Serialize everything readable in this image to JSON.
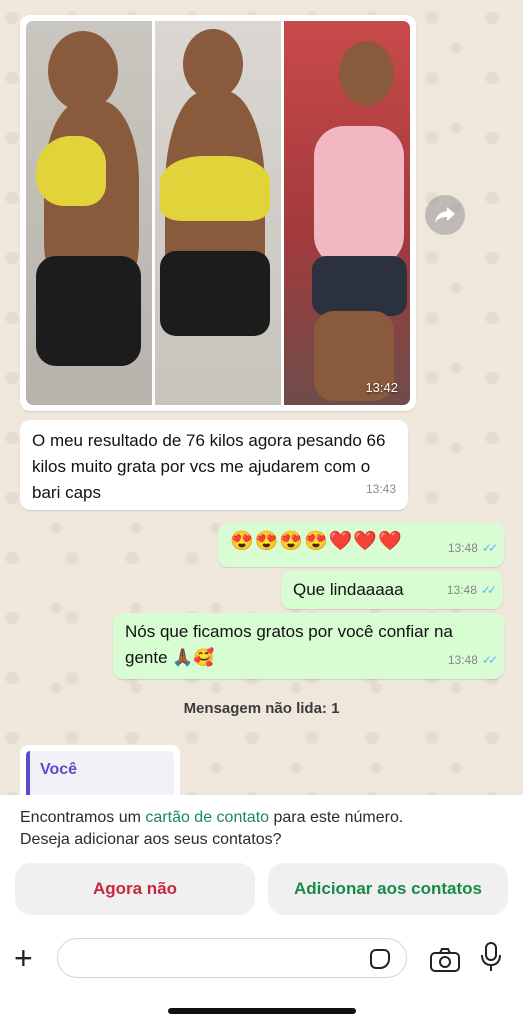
{
  "messages": {
    "image_time": "13:42",
    "incoming_text": "O meu resultado de 76 kilos agora pesando 66 kilos muito grata por vcs me ajudarem com o bari caps",
    "incoming_time": "13:43",
    "outgoing": [
      {
        "text": "😍😍😍😍❤️❤️❤️",
        "time": "13:48"
      },
      {
        "text": "Que lindaaaaa",
        "time": "13:48"
      },
      {
        "text": "Nós que ficamos gratos por você confiar na gente 🙏🏾🥰",
        "time": "13:48"
      }
    ]
  },
  "unread_label": "Mensagem não lida: 1",
  "reply_preview": {
    "sender": "Você"
  },
  "contact_banner": {
    "prefix": "Encontramos um ",
    "link": "cartão de contato",
    "suffix": " para este número.",
    "line2": "Deseja adicionar aos seus contatos?",
    "decline_label": "Agora não",
    "accept_label": "Adicionar aos contatos"
  },
  "input": {
    "placeholder": ""
  },
  "colors": {
    "outgoing_bubble": "#d9fdd3",
    "accent_green": "#1a8a4a",
    "decline_red": "#c8283f",
    "read_ticks": "#53bdeb"
  }
}
